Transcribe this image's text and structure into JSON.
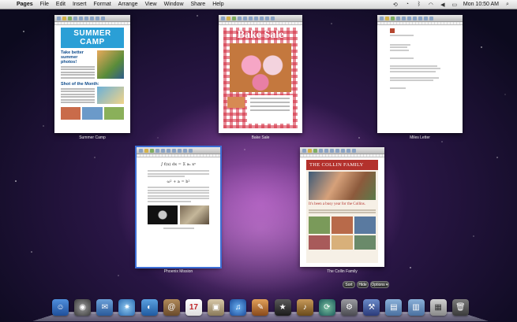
{
  "menubar": {
    "app_name": "Pages",
    "menus": [
      "File",
      "Edit",
      "Insert",
      "Format",
      "Arrange",
      "View",
      "Window",
      "Share",
      "Help"
    ],
    "clock": "Mon 10:50 AM"
  },
  "windows": [
    {
      "label": "Summer Camp"
    },
    {
      "label": "Bake Sale"
    },
    {
      "label": "Miles Letter"
    },
    {
      "label": "Phoenix Mission"
    },
    {
      "label": "The Collin Family"
    }
  ],
  "summer_camp": {
    "title": "SUMMER CAMP",
    "subhead": "Take better summer photos!",
    "section": "Shot of the Month:"
  },
  "bake_sale": {
    "title": "Bake Sale"
  },
  "collin": {
    "title": "THE COLLIN FAMILY",
    "headline": "It's been a busy year for the Collins."
  },
  "phoenix": {
    "formula": "∫ f(x) dx = Σ aₙ xⁿ",
    "formula2": "ω² + a = b²"
  },
  "controls": {
    "sort_label": "Sort",
    "hide_label": "Hide",
    "options_label": "Options ▾"
  },
  "colors": {
    "selection": "#3d6fd6",
    "summer_camp_blue": "#2a9fd6",
    "collin_red": "#b3312c"
  }
}
